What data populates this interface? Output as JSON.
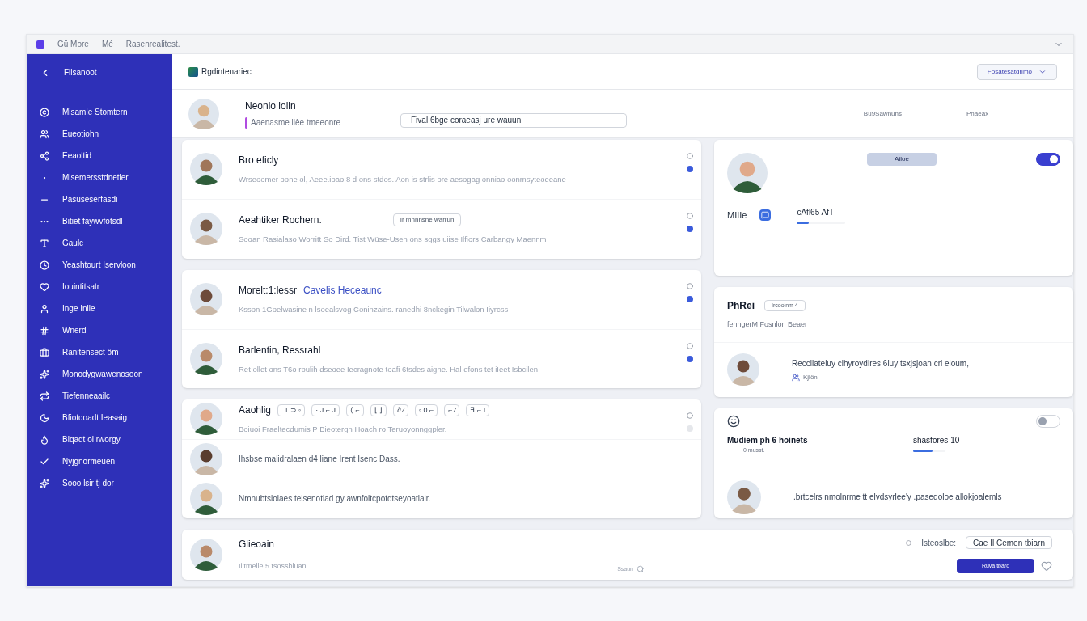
{
  "titlebar": {
    "tabs": [
      "Gü More",
      "Mé"
    ],
    "title": "Rasenrealitest."
  },
  "sidebar": {
    "back": "Filsanoot",
    "items": [
      {
        "label": "Misamle Stomtern",
        "selected": false
      },
      {
        "label": "Eueotiohn",
        "selected": false
      },
      {
        "label": "Eeaoltid",
        "selected": false
      },
      {
        "label": "Misemersstdnetler",
        "selected": false
      },
      {
        "label": "Pasuseserfasdi",
        "selected": false
      },
      {
        "label": "Bitiet faywvfotsdl",
        "selected": false
      },
      {
        "label": "Gaulc",
        "selected": false
      },
      {
        "label": "Yeashtourt Iservloon",
        "selected": false
      },
      {
        "label": "Iouintitsatr",
        "selected": false
      },
      {
        "label": "Inge Inlle",
        "selected": false
      },
      {
        "label": "Wnerd",
        "selected": false
      },
      {
        "label": "Ranitensect ôm",
        "selected": false
      },
      {
        "label": "Monodygwawenosoon",
        "selected": false
      },
      {
        "label": "Tiefenneaailc",
        "selected": false
      },
      {
        "label": "Bfiotqoadt Ieasaig",
        "selected": false
      },
      {
        "label": "Biqadt ol rworgy",
        "selected": false
      },
      {
        "label": "Nyjgnormeuen",
        "selected": false
      },
      {
        "label": "Sooo lsir tj dor",
        "selected": false
      }
    ]
  },
  "header": {
    "title": "Rgdintenariec",
    "dropdown": "Fösätesätdrimo"
  },
  "top_row": {
    "name": "Neonlo lolin",
    "subtitle": "Aaenasme llèe tmeeonre",
    "field_value": "Fival 6bge  coraeasj ure wauun",
    "column_1": "Bu9Sawnuns",
    "column_2": "Pnaeax"
  },
  "left_cards": [
    {
      "rows": [
        {
          "name": "Bro eficly",
          "text": "Wrseoomer oone ol, Aeee.ioao 8 d ons stdos. Aon is strlis ore aesogag onniao oonmsyteoeeane",
          "unread": true
        },
        {
          "name": "Aeahtiker Rochern.",
          "tag": "Ir mnnnsne warruh",
          "text": "Sooan Rasialaso Worritt    So Dird.    Tist    Wüse-Usen ons sggs uiise  Ilfiors  Carbangy Maennm",
          "unread": true
        }
      ]
    },
    {
      "rows": [
        {
          "name": "Morelt:1:lessr",
          "link": "Cavelis Heceaunc",
          "text": "Ksson 1Goelwasine n lsoealsvog Coninzains. ranedhi 8nckegin Tilwalon Iiyrcss",
          "unread": true
        },
        {
          "name": "Barlentin, Ressrahl",
          "text": "Ret ollet ons T6o rpulih dseoee Iecragnote toafi 6tsdes aigne. Hal efons tet iIeet Isbcilen",
          "unread": true
        }
      ]
    },
    {
      "rows": [
        {
          "name": "Aaohlig",
          "chips": [
            "⊐ ⊃ ◦",
            "· J  ⌐ J",
            "⟨ ⌐",
            "⌊ ⌋",
            "∂ ⁄",
            "◦ 0 ⌐",
            "⌐ ⁄",
            "∃ ⌐ I"
          ],
          "text": "Boiuoi Fraeltecdumis P Bieotergn Hoach ro Teruoyonnggpler.",
          "unread": false
        },
        {
          "note": "Ihsbse malidralaen d4 liane Irent Isenc Dass."
        },
        {
          "note": "Nmnubtsloiaes telsenotlad gy awnfoltcpotdtseyoatlair."
        }
      ]
    }
  ],
  "right_cards": [
    {
      "kind": "profile",
      "button": "Ailoe",
      "toggle_on": true,
      "label": "MIIIe",
      "stat": "cAfl65 AfT",
      "level": 0.25
    },
    {
      "kind": "details",
      "title": "PhRei",
      "badge": "Ircooinm 4",
      "subtitle": "fenngerM  Fosnlon Beaer",
      "quote": "Reccilateluy cihyroydlres 6luy tsxjsjoan cri eloum,",
      "quote_meta": "Kjlön"
    },
    {
      "kind": "stats",
      "toggle_on": false,
      "title": "Mudiem ph 6 hoinets",
      "meta": "0 musst.",
      "stat": "shasfores 10",
      "level": 0.6,
      "quote": ".brtcelrs nmolnrme tt elvdsyrlee'y .pasedoloe allokjoalemls"
    }
  ],
  "footer_card": {
    "name": "Glieoain",
    "text": "Iiitmelle 5 tsossbluan.",
    "hint": "Ssaun",
    "filter": "Isteoslbe:",
    "field_value": "Cae  Il Cemen tbiarn",
    "button": "Ruva tbard"
  }
}
